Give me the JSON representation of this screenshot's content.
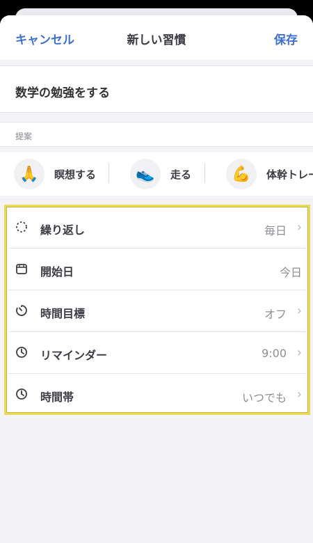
{
  "nav": {
    "cancel": "キャンセル",
    "title": "新しい習慣",
    "save": "保存"
  },
  "habit_name": "数学の勉強をする",
  "suggestions": {
    "header": "提案",
    "items": [
      {
        "emoji": "🙏",
        "label": "瞑想する"
      },
      {
        "emoji": "👟",
        "label": "走る"
      },
      {
        "emoji": "💪",
        "label": "体幹トレー"
      }
    ]
  },
  "settings": [
    {
      "label": "繰り返し",
      "value": "毎日",
      "icon": "repeat-dotted-circle-icon"
    },
    {
      "label": "開始日",
      "value": "今日",
      "icon": "calendar-icon"
    },
    {
      "label": "時間目標",
      "value": "オフ",
      "icon": "timer-icon"
    },
    {
      "label": "リマインダー",
      "value": "9:00",
      "icon": "clock-icon"
    },
    {
      "label": "時間帯",
      "value": "いつでも",
      "icon": "clock-icon"
    }
  ],
  "colors": {
    "accent": "#3f6fd1",
    "highlight_border": "#e8d95a"
  }
}
